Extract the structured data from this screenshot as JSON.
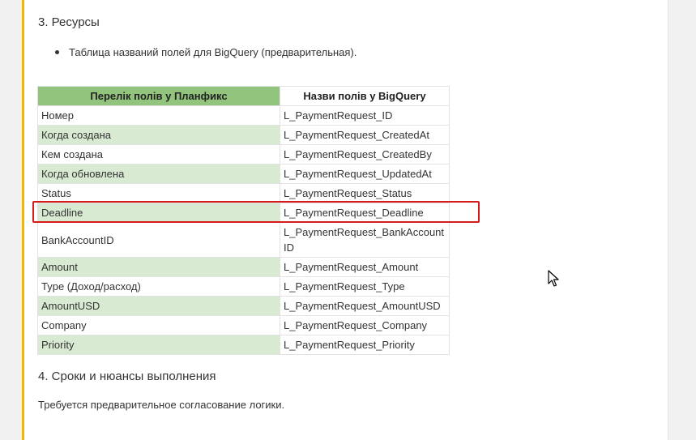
{
  "section3": {
    "heading": "3. Ресурсы",
    "bullet": "Таблица названий полей для BigQuery (предварительная)."
  },
  "table": {
    "headers": [
      "Перелік полів у Планфикс",
      "Назви полів у BigQuery"
    ],
    "rows": [
      {
        "field": "Номер",
        "bq": "L_PaymentRequest_ID",
        "shaded": false
      },
      {
        "field": "Когда создана",
        "bq": "L_PaymentRequest_CreatedAt",
        "shaded": true
      },
      {
        "field": "Кем создана",
        "bq": "L_PaymentRequest_CreatedBy",
        "shaded": false
      },
      {
        "field": "Когда обновлена",
        "bq": "L_PaymentRequest_UpdatedAt",
        "shaded": true
      },
      {
        "field": "Status",
        "bq": "L_PaymentRequest_Status",
        "shaded": false
      },
      {
        "field": "Deadline",
        "bq": "L_PaymentRequest_Deadline",
        "shaded": true,
        "highlighted": true
      },
      {
        "field": "BankAccountID",
        "bq": "L_PaymentRequest_BankAccountID",
        "shaded": false
      },
      {
        "field": "Amount",
        "bq": "L_PaymentRequest_Amount",
        "shaded": true
      },
      {
        "field": "Type (Доход/расход)",
        "bq": "L_PaymentRequest_Type",
        "shaded": false
      },
      {
        "field": "AmountUSD",
        "bq": "L_PaymentRequest_AmountUSD",
        "shaded": true
      },
      {
        "field": "Company",
        "bq": "L_PaymentRequest_Company",
        "shaded": false
      },
      {
        "field": "Priority",
        "bq": "L_PaymentRequest_Priority",
        "shaded": true
      }
    ]
  },
  "section4": {
    "heading": "4. Сроки и нюансы выполнения",
    "text": "Требуется предварительное согласование логики."
  },
  "colors": {
    "accent_border": "#f5b400",
    "header_green": "#93c47d",
    "row_green": "#d9ead3",
    "highlight_red": "#d61b1b"
  },
  "icons": {
    "cursor": "mouse-pointer-icon",
    "bullet": "bullet-dot-icon"
  }
}
